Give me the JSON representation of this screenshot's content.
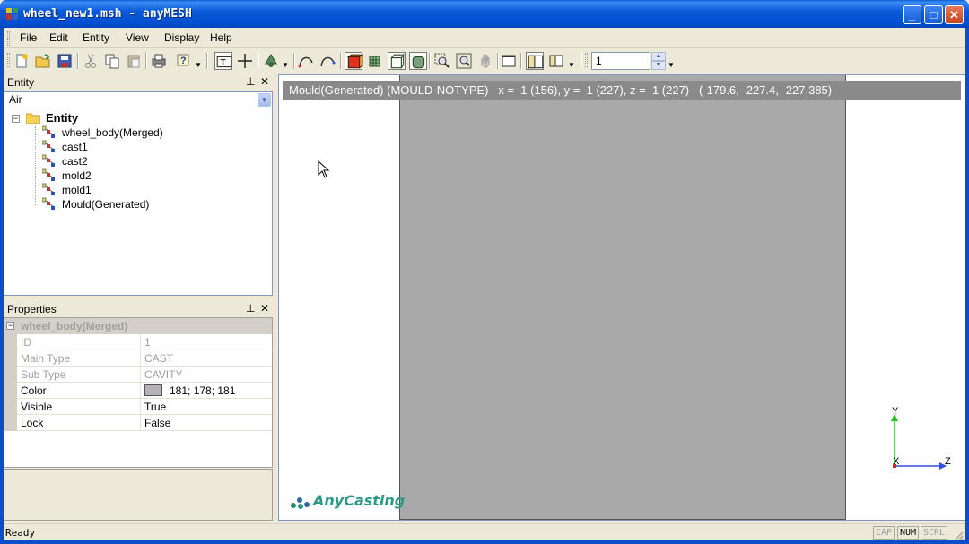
{
  "window": {
    "title": "wheel_new1.msh - anyMESH",
    "minimize": "_",
    "maximize": "□",
    "close": "✕"
  },
  "menu": {
    "file": "File",
    "edit": "Edit",
    "entity": "Entity",
    "view": "View",
    "display": "Display",
    "help": "Help"
  },
  "toolbar": {
    "layer_value": "1",
    "icons": [
      "new-icon",
      "open-icon",
      "save-icon",
      "cut-icon",
      "copy-icon",
      "paste-icon",
      "print-icon",
      "help-icon",
      "text-icon",
      "crosshair-icon",
      "shape-icon",
      "curve-icon",
      "curve2-icon",
      "solid-cube-icon",
      "mesh-cube-icon",
      "wire-cube-icon",
      "shaded-cube-icon",
      "zoom-window-icon",
      "zoom-fit-icon",
      "pan-icon",
      "single-view-icon",
      "split-view-icon",
      "layout-view-icon"
    ]
  },
  "entity_pane": {
    "title": "Entity",
    "pin": "📌",
    "close": "✕",
    "combo_value": "Air",
    "root_label": "Entity",
    "items": [
      "wheel_body(Merged)",
      "cast1",
      "cast2",
      "mold2",
      "mold1",
      "Mould(Generated)"
    ]
  },
  "properties_pane": {
    "title": "Properties",
    "group": "wheel_body(Merged)",
    "rows": [
      {
        "name": "ID",
        "value": "1"
      },
      {
        "name": "Main Type",
        "value": "CAST"
      },
      {
        "name": "Sub Type",
        "value": "CAVITY"
      },
      {
        "name": "Color",
        "value": "181; 178; 181"
      },
      {
        "name": "Visible",
        "value": "True"
      },
      {
        "name": "Lock",
        "value": "False"
      }
    ],
    "swatch_color": "#b5b2b5"
  },
  "viewport": {
    "info": "Mould(Generated) (MOULD-NOTYPE)   x =  1 (156), y =  1 (227), z =  1 (227)   (-179.6, -227.4, -227.385)",
    "logo": "AnyCasting",
    "axis_y": "Y",
    "axis_x": "X",
    "axis_z": "Z",
    "mould_color": "#a9a9a9"
  },
  "status": {
    "text": "Ready",
    "cap": "CAP",
    "num": "NUM",
    "scrl": "SCRL"
  }
}
